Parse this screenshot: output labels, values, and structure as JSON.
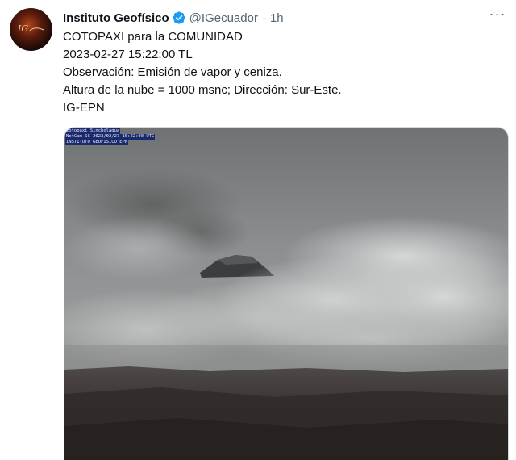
{
  "tweet": {
    "author_name": "Instituto Geofísico",
    "handle": "@IGecuador",
    "separator": "·",
    "time": "1h",
    "more_label": "···",
    "lines": [
      "COTOPAXI para la COMUNIDAD",
      "2023-02-27 15:22:00 TL",
      "Observación: Emisión de vapor y ceniza.",
      "Altura de la nube = 1000 msnc; Dirección: Sur-Este.",
      "IG-EPN"
    ]
  },
  "media": {
    "overlay": [
      "Cotopaxi Sincholagua",
      "NetCam SC 2023/02/27 15:22:00 UTC",
      "INSTITUTO GEOFISICO EPN"
    ]
  },
  "colors": {
    "verified": "#1d9bf0",
    "text": "#0f1419",
    "secondary": "#536471"
  },
  "icons": {
    "verified": "verified-badge-icon",
    "more": "more-options-icon"
  }
}
